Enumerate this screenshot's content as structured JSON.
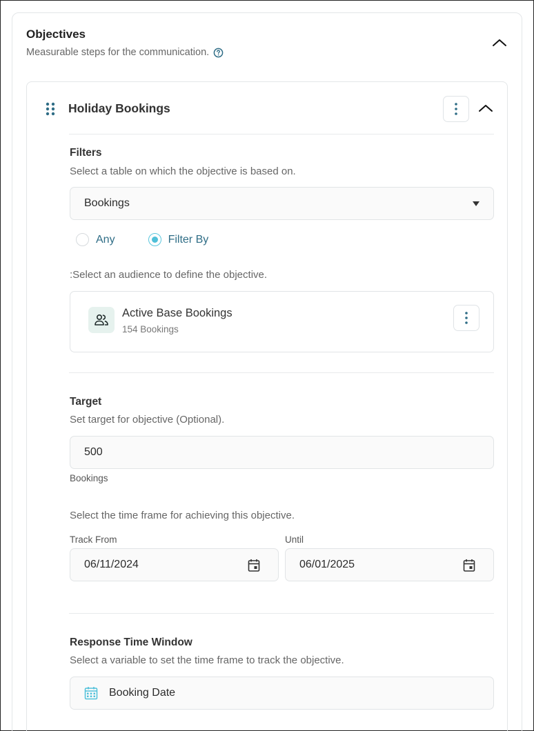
{
  "objectives": {
    "title": "Objectives",
    "subtitle": "Measurable steps for the communication."
  },
  "item": {
    "title": "Holiday Bookings"
  },
  "filters": {
    "title": "Filters",
    "subtitle": "Select a table on which the objective is based on.",
    "table_value": "Bookings",
    "radio_any": "Any",
    "radio_filter_by": "Filter By",
    "selected_radio": "Filter By",
    "audience_prompt": ":Select an audience to define the objective.",
    "audience": {
      "name": "Active Base Bookings",
      "count": "154 Bookings"
    }
  },
  "target": {
    "title": "Target",
    "subtitle": "Set target for objective (Optional).",
    "value": "500",
    "unit": "Bookings",
    "timeframe_prompt": "Select the time frame for achieving this objective.",
    "track_from_label": "Track From",
    "track_from_value": "06/11/2024",
    "until_label": "Until",
    "until_value": "06/01/2025"
  },
  "response_window": {
    "title": "Response Time Window",
    "subtitle": "Select a variable to set the time frame to track the objective.",
    "value": "Booking Date"
  },
  "colors": {
    "accent_teal": "#2f6d86",
    "radio_checked": "#4fc0d9",
    "audience_icon_bg": "#e6f2ee",
    "border": "#e1e4e6"
  }
}
